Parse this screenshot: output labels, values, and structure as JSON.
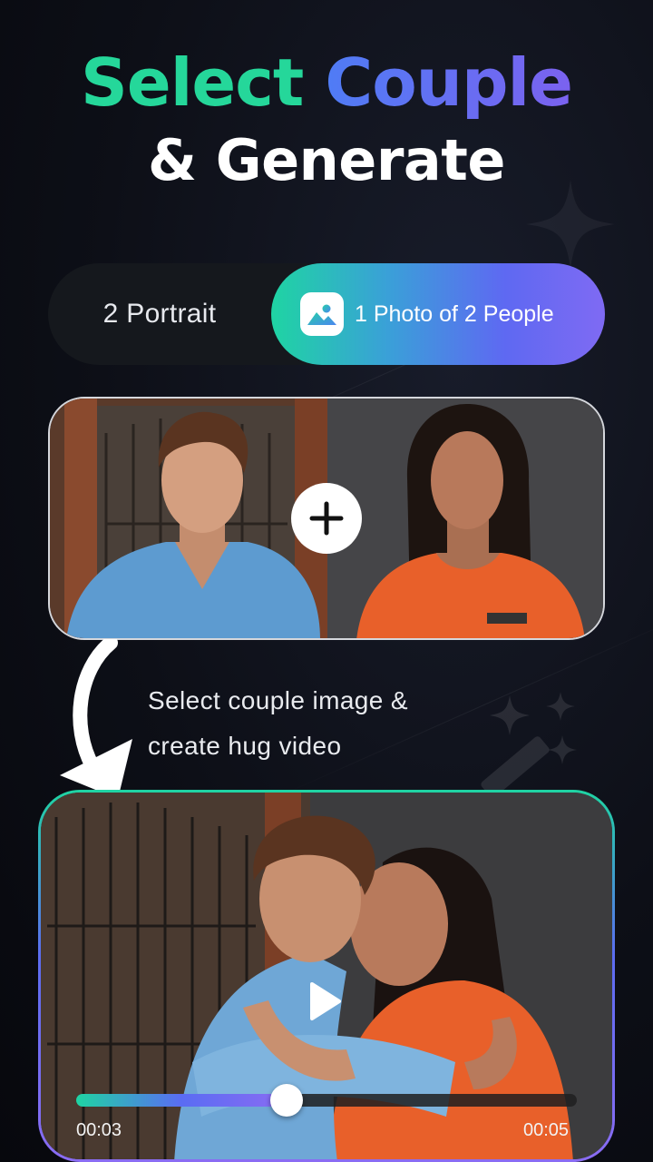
{
  "headline": {
    "word1": "Select",
    "word2": "Couple",
    "line2": "& Generate"
  },
  "mode_toggle": {
    "option_portrait": "2 Portrait",
    "option_one_photo": "1 Photo of 2 People",
    "selected": "1 Photo of 2 People",
    "icon": "image-icon"
  },
  "input_card": {
    "left_photo": "man-portrait-photo",
    "right_photo": "woman-portrait-photo",
    "center_icon": "plus-icon"
  },
  "caption": {
    "line1": "Select couple image &",
    "line2": "create hug video"
  },
  "video_player": {
    "thumbnail": "couple-hug-photo",
    "play_icon": "play-icon",
    "current_time": "00:03",
    "total_time": "00:05",
    "progress": 0.42
  },
  "colors": {
    "accent_green": "#25d79a",
    "accent_blue": "#4f7cf5",
    "accent_purple": "#7f6af3",
    "background": "#0d0f17"
  }
}
